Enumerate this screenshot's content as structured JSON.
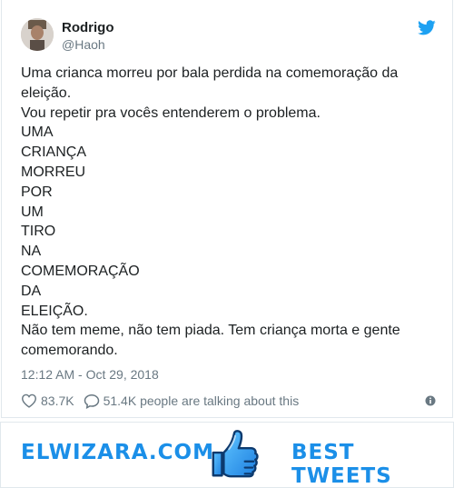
{
  "tweet": {
    "author_name": "Rodrigo",
    "author_handle": "@Haoh",
    "lines": [
      "Uma crianca morreu por bala perdida na comemoração da",
      "eleição.",
      "Vou repetir pra vocês entenderem o problema.",
      "UMA",
      "CRIANÇA",
      "MORREU",
      "POR",
      "UM",
      "TIRO",
      "NA",
      "COMEMORAÇÃO",
      "DA",
      "ELEIÇÃO.",
      "Não tem meme, não tem piada. Tem criança morta e gente",
      "comemorando."
    ],
    "timestamp": "12:12 AM - Oct 29, 2018",
    "likes": "83.7K",
    "replies_text": "51.4K people are talking about this"
  },
  "banner": {
    "left_text": "ELWIZARA.COM",
    "right_text": "BEST TWEETS"
  },
  "colors": {
    "twitter_blue": "#1da1f2",
    "brand_blue": "#1b8fe8",
    "text_dark": "#1c2022",
    "text_gray": "#697882"
  },
  "icons": {
    "bird": "twitter-bird-icon",
    "like": "heart-icon",
    "reply": "speech-bubble-icon",
    "info": "info-icon",
    "thumb": "thumbs-up-icon"
  }
}
